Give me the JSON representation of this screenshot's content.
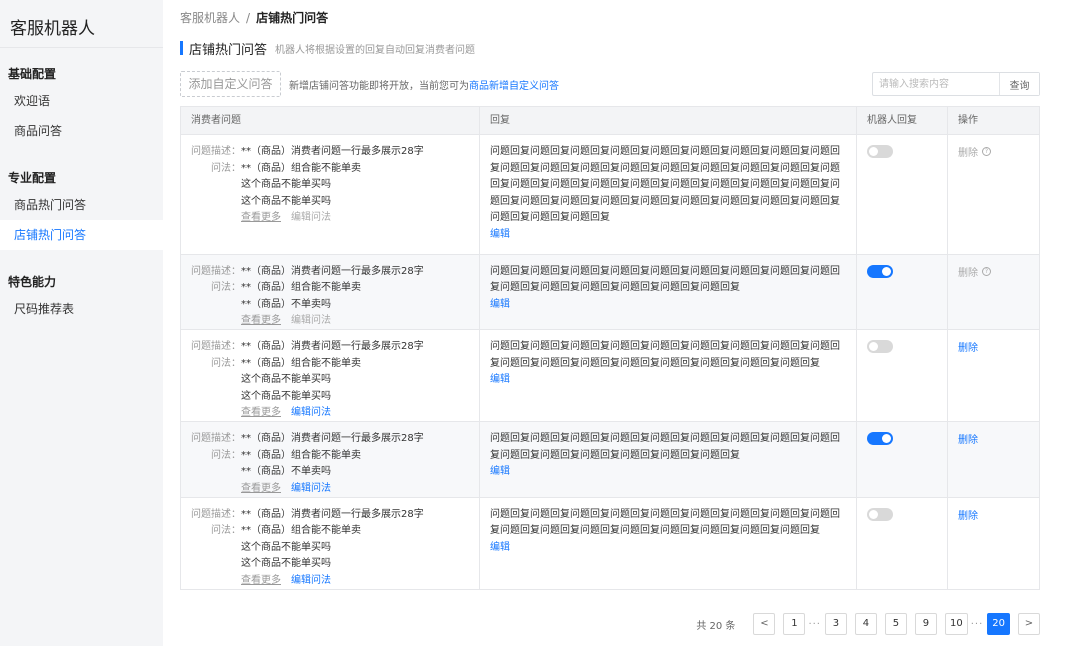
{
  "app": {
    "title": "客服机器人"
  },
  "sidebar": {
    "groups": [
      {
        "title": "基础配置",
        "items": [
          "欢迎语",
          "商品问答"
        ]
      },
      {
        "title": "专业配置",
        "items": [
          "商品热门问答",
          "店铺热门问答"
        ]
      },
      {
        "title": "特色能力",
        "items": [
          "尺码推荐表"
        ]
      }
    ],
    "active_item": "店铺热门问答"
  },
  "breadcrumb": {
    "root": "客服机器人",
    "separator": "/",
    "current": "店铺热门问答"
  },
  "page": {
    "title": "店铺热门问答",
    "description": "机器人将根据设置的回复自动回复消费者问题"
  },
  "toolbar": {
    "add_button": "添加自定义问答",
    "notice_text": "新增店铺问答功能即将开放，当前您可为",
    "notice_link": "商品新增自定义问答",
    "search_placeholder": "请输入搜索内容",
    "search_button": "查询"
  },
  "table": {
    "headers": [
      "消费者问题",
      "回复",
      "机器人回复",
      "操作"
    ],
    "labels": {
      "desc": "问题描述：",
      "ask": "问法：",
      "more": "查看更多",
      "edit_ask": "编辑问法",
      "edit_reply": "编辑",
      "delete": "删除"
    },
    "rows": [
      {
        "desc": "**（商品）消费者问题一行最多展示28字",
        "asks": [
          "**（商品）组合能不能单卖",
          "这个商品不能单买吗",
          "这个商品不能单买吗"
        ],
        "reply": "问题回复问题回复问题回复问题回复问题回复问题回复问题回复问题回复问题回复问题回复问题回复问题回复问题回复问题回复问题回复问题回复问题回复问题回复问题回复问题回复问题回复问题回复问题回复问题回复问题回复问题回复问题回复问题回复问题回复问题回复问题回复问题回复问题回复问题回复问题回复问题回复问题回复问题回复",
        "robot_on": false,
        "delete_enabled": false,
        "edit_enabled": false
      },
      {
        "desc": "**（商品）消费者问题一行最多展示28字",
        "asks": [
          "**（商品）组合能不能单卖",
          "**（商品）不单卖吗"
        ],
        "reply": "问题回复问题回复问题回复问题回复问题回复问题回复问题回复问题回复问题回复问题回复问题回复问题回复问题回复问题回复问题回复",
        "robot_on": true,
        "delete_enabled": false,
        "edit_enabled": false
      },
      {
        "desc": "**（商品）消费者问题一行最多展示28字",
        "asks": [
          "**（商品）组合能不能单卖",
          "这个商品不能单买吗",
          "这个商品不能单买吗"
        ],
        "reply": "问题回复问题回复问题回复问题回复问题回复问题回复问题回复问题回复问题回复问题回复问题回复问题回复问题回复问题回复问题回复问题回复问题回复",
        "robot_on": false,
        "delete_enabled": true,
        "edit_enabled": true
      },
      {
        "desc": "**（商品）消费者问题一行最多展示28字",
        "asks": [
          "**（商品）组合能不能单卖",
          "**（商品）不单卖吗"
        ],
        "reply": "问题回复问题回复问题回复问题回复问题回复问题回复问题回复问题回复问题回复问题回复问题回复问题回复问题回复问题回复问题回复",
        "robot_on": true,
        "delete_enabled": true,
        "edit_enabled": true
      },
      {
        "desc": "**（商品）消费者问题一行最多展示28字",
        "asks": [
          "**（商品）组合能不能单卖",
          "这个商品不能单买吗",
          "这个商品不能单买吗"
        ],
        "reply": "问题回复问题回复问题回复问题回复问题回复问题回复问题回复问题回复问题回复问题回复问题回复问题回复问题回复问题回复问题回复问题回复问题回复",
        "robot_on": false,
        "delete_enabled": true,
        "edit_enabled": true
      }
    ]
  },
  "pagination": {
    "total_text": "共 20 条",
    "prev": "<",
    "next": ">",
    "ellipsis": "···",
    "pages": [
      "1",
      "...",
      "3",
      "4",
      "5",
      "9",
      "10",
      "...",
      "20"
    ],
    "current": "20"
  },
  "icons": {
    "help": "question-circle-icon",
    "toggle": "switch-icon"
  },
  "colors": {
    "primary": "#1677ff",
    "sidebar_bg": "#f4f5f7"
  }
}
